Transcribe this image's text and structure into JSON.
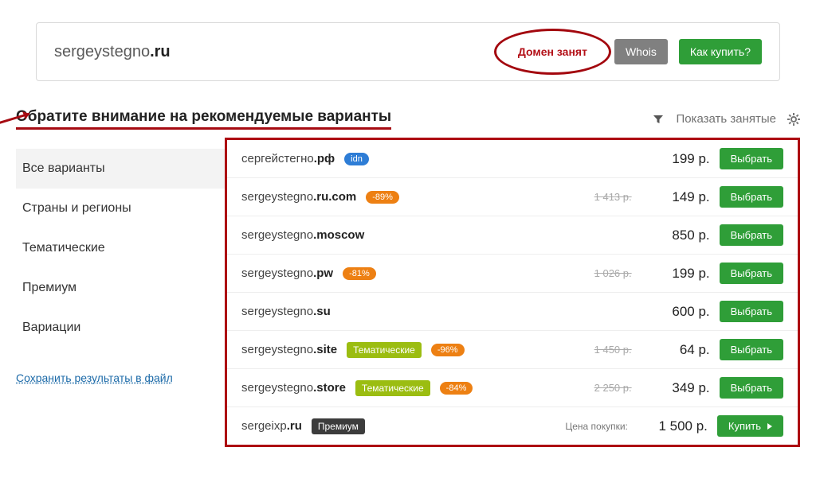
{
  "search": {
    "domain_base": "sergeystegno",
    "domain_tld": ".ru",
    "taken_label": "Домен занят",
    "whois_label": "Whois",
    "howto_label": "Как купить?"
  },
  "heading": "Обратите внимание на рекомендуемые варианты",
  "toolbar": {
    "show_taken": "Показать занятые"
  },
  "sidebar": [
    "Все варианты",
    "Страны и регионы",
    "Тематические",
    "Премиум",
    "Вариации"
  ],
  "save_link": "Сохранить результаты в файл",
  "button_select": "Выбрать",
  "button_buy": "Купить",
  "price_label": "Цена покупки:",
  "rows": [
    {
      "name": "сергейстегно",
      "tld": ".рф",
      "badges": [
        {
          "text": "idn",
          "cls": "blue"
        }
      ],
      "old": "",
      "price": "199 р."
    },
    {
      "name": "sergeystegno",
      "tld": ".ru.com",
      "badges": [
        {
          "text": "-89%",
          "cls": "orange"
        }
      ],
      "old": "1 413 р.",
      "price": "149 р."
    },
    {
      "name": "sergeystegno",
      "tld": ".moscow",
      "badges": [],
      "old": "",
      "price": "850 р."
    },
    {
      "name": "sergeystegno",
      "tld": ".pw",
      "badges": [
        {
          "text": "-81%",
          "cls": "orange"
        }
      ],
      "old": "1 026 р.",
      "price": "199 р."
    },
    {
      "name": "sergeystegno",
      "tld": ".su",
      "badges": [],
      "old": "",
      "price": "600 р."
    },
    {
      "name": "sergeystegno",
      "tld": ".site",
      "badges": [
        {
          "text": "Тематические",
          "cls": "lime"
        },
        {
          "text": "-96%",
          "cls": "orange"
        }
      ],
      "old": "1 450 р.",
      "price": "64 р."
    },
    {
      "name": "sergeystegno",
      "tld": ".store",
      "badges": [
        {
          "text": "Тематические",
          "cls": "lime"
        },
        {
          "text": "-84%",
          "cls": "orange"
        }
      ],
      "old": "2 250 р.",
      "price": "349 р."
    },
    {
      "name": "sergeixp",
      "tld": ".ru",
      "badges": [
        {
          "text": "Премиум",
          "cls": "dark"
        }
      ],
      "old": "",
      "price": "1 500 р.",
      "buy": true,
      "show_label": true
    }
  ]
}
